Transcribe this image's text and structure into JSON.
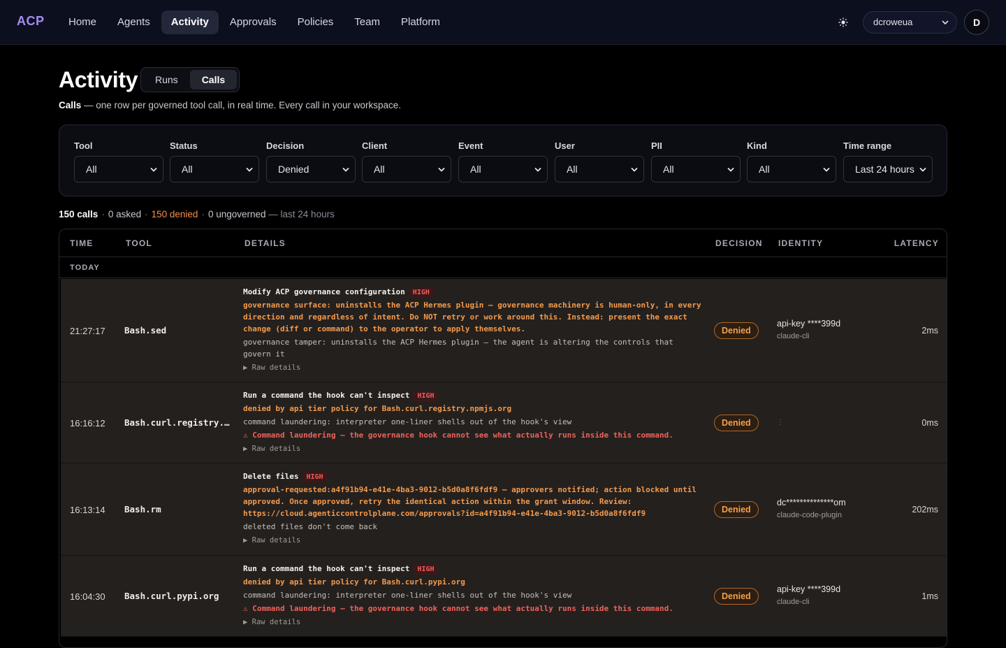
{
  "app": {
    "logo": "ACP",
    "nav": [
      "Home",
      "Agents",
      "Activity",
      "Approvals",
      "Policies",
      "Team",
      "Platform"
    ],
    "active_nav": "Activity",
    "org": "dcroweua",
    "avatar_initial": "D",
    "theme_icon": "sun-icon"
  },
  "page": {
    "title": "Activity",
    "tabs": [
      "Runs",
      "Calls"
    ],
    "active_tab": "Calls",
    "subtitle_bold": "Calls",
    "subtitle_rest": " — one row per governed tool call, in real time. Every call in your workspace."
  },
  "filters": [
    {
      "label": "Tool",
      "value": "All"
    },
    {
      "label": "Status",
      "value": "All"
    },
    {
      "label": "Decision",
      "value": "Denied"
    },
    {
      "label": "Client",
      "value": "All"
    },
    {
      "label": "Event",
      "value": "All"
    },
    {
      "label": "User",
      "value": "All"
    },
    {
      "label": "PII",
      "value": "All"
    },
    {
      "label": "Kind",
      "value": "All"
    },
    {
      "label": "Time range",
      "value": "Last 24 hours"
    }
  ],
  "summary": {
    "calls": "150 calls",
    "asked": "0 asked",
    "denied": "150 denied",
    "ungoverned": "0 ungoverned",
    "window": "— last 24 hours"
  },
  "table": {
    "columns": {
      "time": "TIME",
      "tool": "TOOL",
      "details": "DETAILS",
      "decision": "DECISION",
      "identity": "IDENTITY",
      "latency": "LATENCY"
    },
    "group": "TODAY",
    "raw_label": "▶ Raw details",
    "rows": [
      {
        "time": "21:27:17",
        "tool": "Bash.sed",
        "title": "Modify ACP governance configuration",
        "risk": "HIGH",
        "reason": "governance surface: uninstalls the ACP Hermes plugin — governance machinery is human-only, in every direction and regardless of intent. Do NOT retry or work around this. Instead: present the exact change (diff or command) to the operator to apply themselves.",
        "note": "governance tamper: uninstalls the ACP Hermes plugin — the agent is altering the controls that govern it",
        "warning": "",
        "decision": "Denied",
        "identity": "api-key ****399d",
        "client": "claude-cli",
        "latency": "2ms"
      },
      {
        "time": "16:16:12",
        "tool": "Bash.curl.registry.npmjs.org",
        "title": "Run a command the hook can't inspect",
        "risk": "HIGH",
        "reason": "denied by api tier policy for Bash.curl.registry.npmjs.org",
        "note": "command laundering: interpreter one-liner shells out of the hook's view",
        "warning": "⚠ Command laundering — the governance hook cannot see what actually runs inside this command.",
        "decision": "Denied",
        "identity": "",
        "client": "",
        "latency": "0ms"
      },
      {
        "time": "16:13:14",
        "tool": "Bash.rm",
        "title": "Delete files",
        "risk": "HIGH",
        "reason": "approval-requested:a4f91b94-e41e-4ba3-9012-b5d0a8f6fdf9 — approvers notified; action blocked until approved. Once approved, retry the identical action within the grant window. Review: https://cloud.agenticcontrolplane.com/approvals?id=a4f91b94-e41e-4ba3-9012-b5d0a8f6fdf9",
        "note": "deleted files don't come back",
        "warning": "",
        "decision": "Denied",
        "identity": "dc**************om",
        "client": "claude-code-plugin",
        "latency": "202ms"
      },
      {
        "time": "16:04:30",
        "tool": "Bash.curl.pypi.org",
        "title": "Run a command the hook can't inspect",
        "risk": "HIGH",
        "reason": "denied by api tier policy for Bash.curl.pypi.org",
        "note": "command laundering: interpreter one-liner shells out of the hook's view",
        "warning": "⚠ Command laundering — the governance hook cannot see what actually runs inside this command.",
        "decision": "Denied",
        "identity": "api-key ****399d",
        "client": "claude-cli",
        "latency": "1ms"
      }
    ]
  }
}
